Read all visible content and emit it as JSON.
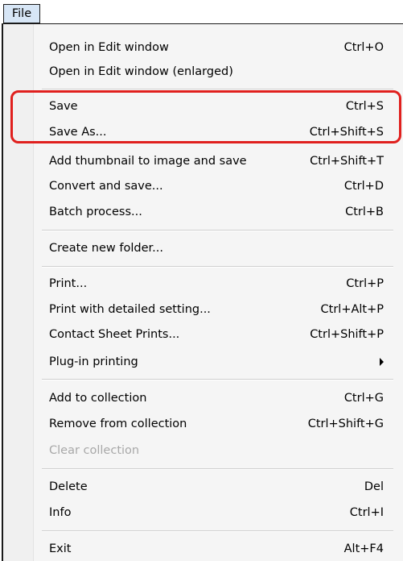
{
  "menubar": {
    "file_label": "File"
  },
  "menu": {
    "items": [
      {
        "label": "Open in Edit window",
        "shortcut": "Ctrl+O"
      },
      {
        "label": "Open in Edit window (enlarged)",
        "shortcut": ""
      },
      {
        "label": "Save",
        "shortcut": "Ctrl+S"
      },
      {
        "label": "Save As...",
        "shortcut": "Ctrl+Shift+S"
      },
      {
        "label": "Add thumbnail to image and save",
        "shortcut": "Ctrl+Shift+T"
      },
      {
        "label": "Convert and save...",
        "shortcut": "Ctrl+D"
      },
      {
        "label": "Batch process...",
        "shortcut": "Ctrl+B"
      },
      {
        "label": "Create new folder...",
        "shortcut": ""
      },
      {
        "label": "Print...",
        "shortcut": "Ctrl+P"
      },
      {
        "label": "Print with detailed setting...",
        "shortcut": "Ctrl+Alt+P"
      },
      {
        "label": "Contact Sheet Prints...",
        "shortcut": "Ctrl+Shift+P"
      },
      {
        "label": "Plug-in printing",
        "shortcut": "",
        "submenu": true
      },
      {
        "label": "Add to collection",
        "shortcut": "Ctrl+G"
      },
      {
        "label": "Remove from collection",
        "shortcut": "Ctrl+Shift+G"
      },
      {
        "label": "Clear collection",
        "shortcut": "",
        "disabled": true
      },
      {
        "label": "Delete",
        "shortcut": "Del"
      },
      {
        "label": "Info",
        "shortcut": "Ctrl+I"
      },
      {
        "label": "Exit",
        "shortcut": "Alt+F4"
      }
    ]
  },
  "highlight_color": "#e0201e"
}
